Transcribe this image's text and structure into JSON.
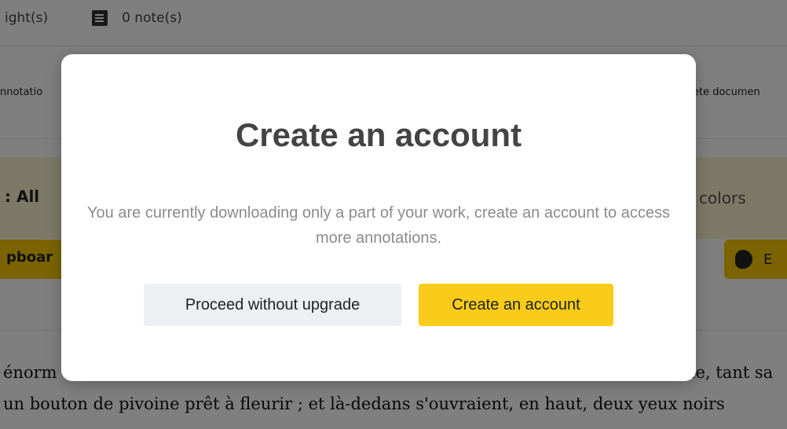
{
  "background": {
    "highlights_count": "ight(s)",
    "notes_icon": "note-icon",
    "notes_count": "0 note(s)",
    "annotations_tab": "nnotatio",
    "delete_document": "ete documen",
    "filter_label": ": All",
    "colors_label": "colors",
    "clipboard_button": "pboar",
    "evernote_icon": "elephant-icon",
    "evernote_button": "E",
    "text_line_1_left": "énorm",
    "text_line_1_right": "ue, tant sa",
    "text_line_2": "un bouton de pivoine prêt à fleurir ; et là-dedans s'ouvraient, en haut, deux yeux noirs",
    "text_line_3": ""
  },
  "modal": {
    "title": "Create an account",
    "description": "You are currently downloading only a part of your work, create an account to access more annotations.",
    "secondary_button": "Proceed without upgrade",
    "primary_button": "Create an account"
  },
  "colors": {
    "overlay": "rgba(0,0,0,0.5)",
    "primary_button_bg": "#f8cc18",
    "secondary_button_bg": "#eeeff2",
    "accent_yellow": "#f5c700"
  }
}
